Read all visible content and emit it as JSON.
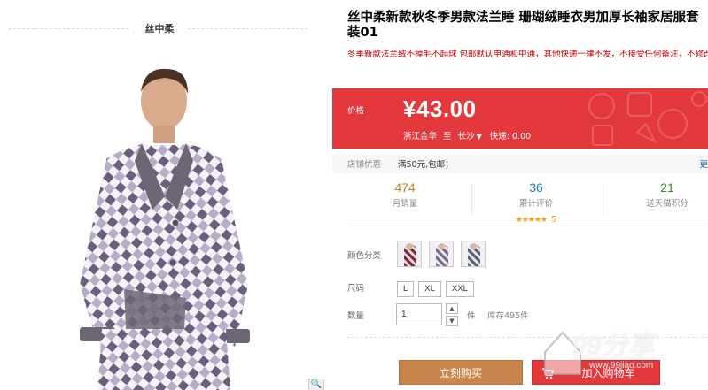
{
  "shop": {
    "name": "丝中柔"
  },
  "product": {
    "title": "丝中柔新款秋冬季男款法兰睡 珊瑚绒睡衣男加厚长袖家居服套装01",
    "description": "冬季新款法兰绒不掉毛不起球 包邮默认申通和中通，其他快递一律不发，不接受任何备注，不修改尺码，不修改颜色。青海 宁夏 甘肃 内蒙古 新疆 西藏不在包邮范围内，需补十元邮"
  },
  "price": {
    "label": "价格",
    "value": "¥43.00",
    "ship_from": "浙江金华",
    "ship_to_word": "至",
    "destination": "长沙",
    "fee_text": "快递: 0.00"
  },
  "promo": {
    "label": "店铺优惠",
    "text": "满50元,包邮；",
    "more": "更"
  },
  "stats": {
    "sales": {
      "value": "474",
      "label": "月销量"
    },
    "reviews": {
      "value": "36",
      "label": "累计评价",
      "stars": "★★★★★",
      "rating": "5"
    },
    "points": {
      "value": "21",
      "label": "送天猫积分"
    }
  },
  "options": {
    "color_label": "颜色分类",
    "size_label": "尺码",
    "sizes": [
      "L",
      "XL",
      "XXL"
    ],
    "quantity_label": "数量",
    "quantity_value": "1",
    "unit": "件",
    "stock": "库存495件"
  },
  "actions": {
    "buy_now": "立刻购买",
    "add_to_cart": "加入购物车"
  },
  "watermark": {
    "text": "99分享",
    "url": "www.99jiao.com"
  },
  "colors": {
    "accent_red": "#e4393c",
    "buy_button": "#c8864a",
    "sales_color": "#c77d1e",
    "reviews_color": "#1a7bb8",
    "points_color": "#3a8b28"
  },
  "icons": [
    "magnify-icon",
    "cart-icon",
    "chevron-down-icon",
    "stepper-up-icon",
    "stepper-down-icon"
  ]
}
